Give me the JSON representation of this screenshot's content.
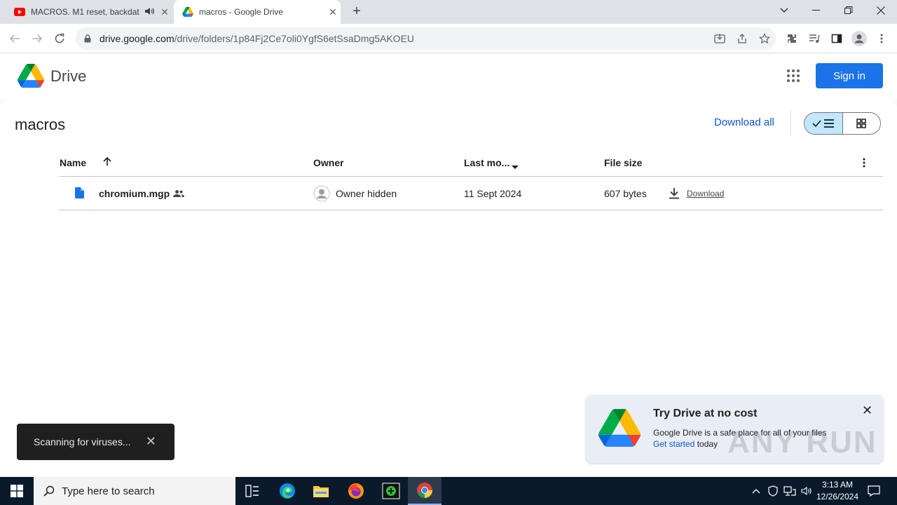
{
  "browser": {
    "tabs": [
      {
        "title": "MACROS. M1 reset, backdat",
        "favicon": "youtube-icon",
        "audio": true,
        "active": false
      },
      {
        "title": "macros - Google Drive",
        "favicon": "google-drive-icon",
        "active": true
      }
    ],
    "url_host": "drive.google.com",
    "url_path": "/drive/folders/1p84Fj2Ce7oli0YgfS6etSsaDmg5AKOEU"
  },
  "drive": {
    "app_name": "Drive",
    "sign_in_label": "Sign in",
    "folder_title": "macros",
    "download_all_label": "Download all",
    "columns": {
      "name": "Name",
      "owner": "Owner",
      "last_modified": "Last mo...",
      "file_size": "File size"
    },
    "files": [
      {
        "name": "chromium.mgp",
        "shared": true,
        "owner": "Owner hidden",
        "last_modified": "11 Sept 2024",
        "file_size": "607 bytes",
        "download_label": "Download"
      }
    ]
  },
  "toast": {
    "message": "Scanning for viruses..."
  },
  "promo": {
    "title": "Try Drive at no cost",
    "description": "Google Drive is a safe place for all of your files",
    "link_label": "Get started",
    "link_suffix": " today"
  },
  "watermark": "ANY RUN",
  "taskbar": {
    "search_placeholder": "Type here to search",
    "time": "3:13 AM",
    "date": "12/26/2024"
  },
  "colors": {
    "accent": "#1a73e8",
    "link": "#0b57d0",
    "toggle_selected": "#c2e7ff",
    "taskbar": "#0b1a2b"
  }
}
